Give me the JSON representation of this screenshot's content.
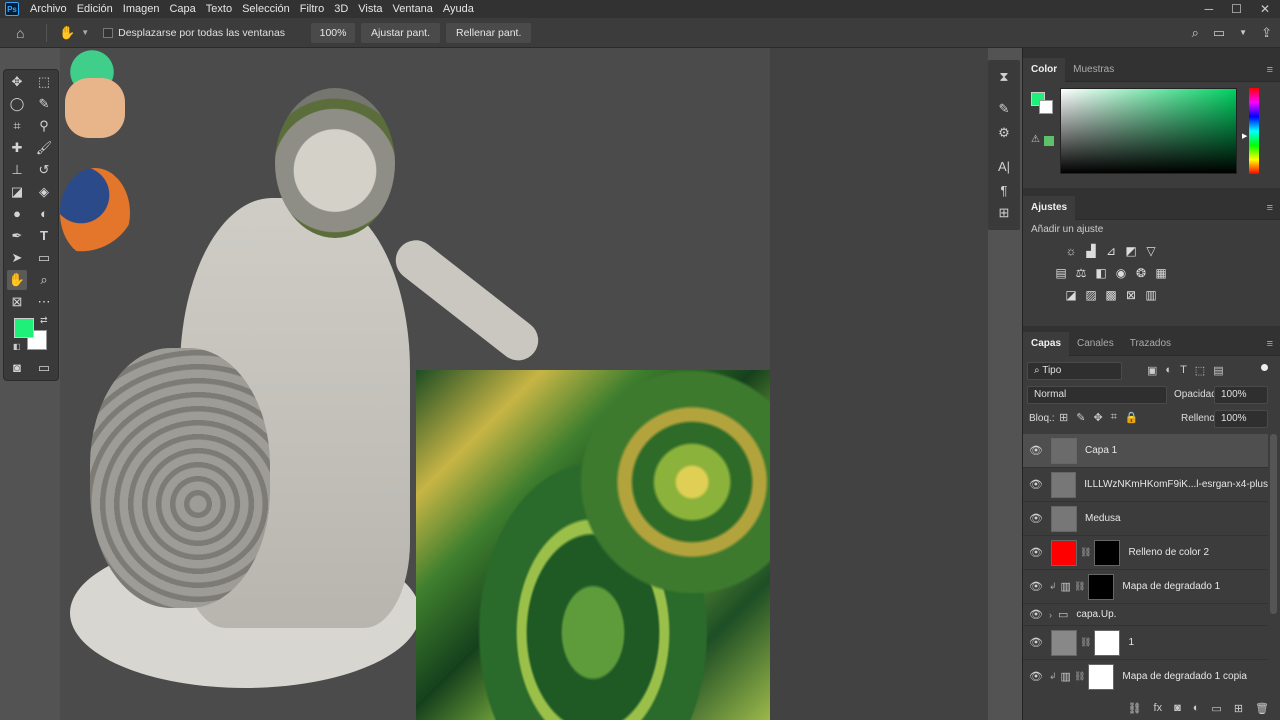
{
  "menubar": {
    "app_logo": "Ps",
    "items": [
      "Archivo",
      "Edición",
      "Imagen",
      "Capa",
      "Texto",
      "Selección",
      "Filtro",
      "3D",
      "Vista",
      "Ventana",
      "Ayuda"
    ]
  },
  "options": {
    "scroll_all_label": "Desplazarse por todas las ventanas",
    "zoom_value": "100%",
    "fit_screen_label": "Ajustar pant.",
    "fill_screen_label": "Rellenar pant."
  },
  "tools": {
    "foreground_color": "#1ff07a",
    "background_color": "#ffffff"
  },
  "color_panel": {
    "tabs": [
      "Color",
      "Muestras"
    ],
    "current_color": "#1ff07a"
  },
  "adjustments_panel": {
    "tab": "Ajustes",
    "add_label": "Añadir un ajuste"
  },
  "layers_panel": {
    "tabs": [
      "Capas",
      "Canales",
      "Trazados"
    ],
    "filter_label": "Tipo",
    "blend_mode": "Normal",
    "opacity_label": "Opacidad:",
    "opacity_value": "100%",
    "lock_label": "Bloq.:",
    "fill_label": "Relleno:",
    "fill_value": "100%",
    "layers": [
      {
        "name": "Capa 1"
      },
      {
        "name": "ILLLWzNKmHKomF9iK...l-esrgan-x4-plus"
      },
      {
        "name": "Medusa"
      },
      {
        "name": "Relleno de color 2"
      },
      {
        "name": "Mapa de degradado 1"
      },
      {
        "name": "capa.Up."
      },
      {
        "name": "1"
      },
      {
        "name": "Mapa de degradado 1 copia"
      }
    ]
  }
}
